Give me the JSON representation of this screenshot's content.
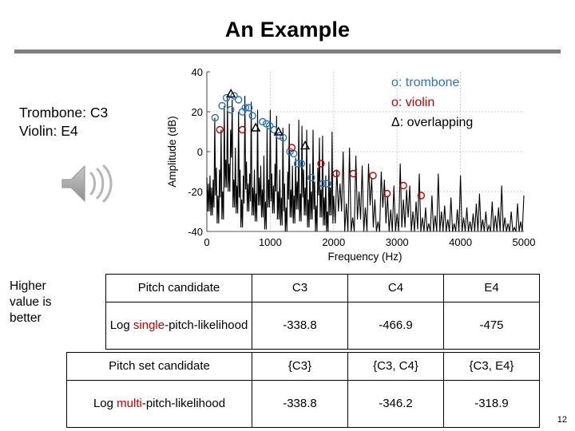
{
  "slide": {
    "title": "An Example",
    "page_number": "12",
    "accent_rule_color": "#808080"
  },
  "caption": {
    "line1": "Trombone: C3",
    "line2": "Violin: E4",
    "audio_icon": "speaker-icon"
  },
  "sidenote": {
    "line1": "Higher",
    "line2": "value is",
    "line3": "better"
  },
  "chart_data": {
    "type": "line",
    "title": "",
    "xlabel": "Frequency (Hz)",
    "ylabel": "Amplitude (dB)",
    "xlim": [
      0,
      5000
    ],
    "ylim": [
      -40,
      40
    ],
    "xticks": [
      0,
      1000,
      2000,
      3000,
      4000,
      5000
    ],
    "yticks": [
      -40,
      -20,
      0,
      20,
      40
    ],
    "grid": true,
    "legend_position": "top-right",
    "legend": [
      {
        "marker": "o",
        "label": "o: trombone",
        "color": "#2E75B6"
      },
      {
        "marker": "o",
        "label": "o: violin",
        "color": "#C00000"
      },
      {
        "marker": "triangle",
        "label": "Δ: overlapping",
        "color": "#000000"
      }
    ],
    "series": [
      {
        "name": "spectrum",
        "color": "#000000",
        "x": [
          0,
          25,
          50,
          75,
          100,
          125,
          150,
          175,
          200,
          225,
          250,
          275,
          300,
          325,
          350,
          375,
          400,
          425,
          450,
          475,
          500,
          525,
          550,
          575,
          600,
          625,
          650,
          675,
          700,
          725,
          750,
          775,
          800,
          825,
          850,
          875,
          900,
          925,
          950,
          975,
          1000,
          1025,
          1050,
          1075,
          1100,
          1125,
          1150,
          1175,
          1200,
          1225,
          1250,
          1275,
          1300,
          1325,
          1350,
          1375,
          1400,
          1425,
          1450,
          1475,
          1500,
          1525,
          1550,
          1575,
          1600,
          1625,
          1650,
          1675,
          1700,
          1725,
          1750,
          1775,
          1800,
          1825,
          1850,
          1875,
          1900,
          1925,
          1950,
          1975,
          2000,
          2050,
          2100,
          2150,
          2200,
          2250,
          2300,
          2350,
          2400,
          2450,
          2500,
          2550,
          2600,
          2650,
          2700,
          2750,
          2800,
          2850,
          2900,
          2950,
          3000,
          3050,
          3100,
          3150,
          3200,
          3250,
          3300,
          3350,
          3400,
          3450,
          3500,
          3550,
          3600,
          3650,
          3700,
          3750,
          3800,
          3850,
          3900,
          3950,
          4000,
          4050,
          4100,
          4150,
          4200,
          4250,
          4300,
          4350,
          4400,
          4450,
          4500,
          4550,
          4600,
          4650,
          4700,
          4750,
          4800,
          4850,
          4900,
          4950,
          5000
        ],
        "y": [
          -13,
          -16,
          -12,
          -18,
          -14,
          17,
          -8,
          -22,
          -9,
          11,
          -20,
          23,
          -4,
          27,
          -6,
          11,
          26,
          -14,
          2,
          -17,
          20,
          -9,
          -24,
          -12,
          28,
          -5,
          -16,
          -11,
          25,
          -18,
          -9,
          -21,
          21,
          -13,
          -7,
          -19,
          -2,
          -25,
          12,
          -14,
          21,
          -11,
          -17,
          -6,
          18,
          -20,
          -9,
          -23,
          12,
          -16,
          -28,
          -10,
          14,
          -19,
          -7,
          -22,
          -3,
          -15,
          16,
          -21,
          13,
          -9,
          -18,
          11,
          -24,
          -6,
          -20,
          11,
          -15,
          -27,
          -8,
          7,
          -19,
          8,
          -23,
          -12,
          -30,
          -5,
          -18,
          10,
          -22,
          -9,
          -16,
          0,
          -26,
          2,
          -33,
          -2,
          -20,
          -7,
          -28,
          -6,
          -13,
          -24,
          -35,
          -10,
          -14,
          -22,
          -29,
          -17,
          -31,
          -6,
          -24,
          -19,
          -17,
          -30,
          -25,
          -11,
          -33,
          -28,
          -36,
          -22,
          -32,
          -11,
          -30,
          -27,
          -34,
          -23,
          -36,
          -29,
          -12,
          -33,
          -28,
          -35,
          -31,
          -26,
          -21,
          -34,
          -30,
          -37,
          -25,
          -32,
          -28,
          -17,
          -33,
          -36,
          -30,
          -38,
          -26,
          -35,
          -22
        ]
      }
    ],
    "markers": {
      "trombone": {
        "color": "#2E75B6",
        "shape": "circle",
        "points": [
          [
            130,
            17
          ],
          [
            240,
            23
          ],
          [
            310,
            27
          ],
          [
            375,
            21
          ],
          [
            430,
            28
          ],
          [
            500,
            26
          ],
          [
            560,
            20
          ],
          [
            610,
            22
          ],
          [
            665,
            22
          ],
          [
            720,
            18
          ],
          [
            880,
            15
          ],
          [
            940,
            14
          ],
          [
            990,
            13
          ],
          [
            1060,
            11
          ],
          [
            1150,
            8
          ],
          [
            1205,
            7
          ],
          [
            1310,
            0
          ],
          [
            1370,
            -1
          ],
          [
            1430,
            -6
          ],
          [
            1490,
            -6
          ],
          [
            1650,
            -13
          ],
          [
            1830,
            -16
          ],
          [
            1900,
            -16
          ]
        ]
      },
      "violin": {
        "color": "#C00000",
        "shape": "circle",
        "points": [
          [
            205,
            11
          ],
          [
            560,
            11
          ],
          [
            1340,
            2
          ],
          [
            1800,
            -6
          ],
          [
            2040,
            -11
          ],
          [
            2310,
            -11
          ],
          [
            2620,
            -12
          ],
          [
            2840,
            -21
          ],
          [
            3100,
            -17
          ],
          [
            3380,
            -22
          ]
        ]
      },
      "overlapping": {
        "color": "#000000",
        "shape": "triangle",
        "points": [
          [
            380,
            29
          ],
          [
            770,
            12
          ],
          [
            1130,
            10
          ],
          [
            1550,
            3
          ]
        ]
      }
    }
  },
  "table_single": {
    "name": "single-pitch-likelihood-table",
    "header": {
      "label": "Pitch candidate",
      "columns": [
        "C3",
        "C4",
        "E4"
      ]
    },
    "row": {
      "label_prefix": "Log ",
      "label_highlight": "single",
      "label_suffix": "-pitch-likelihood",
      "values": [
        {
          "text": "-338.8",
          "color": "green"
        },
        {
          "text": "-466.9",
          "color": "green"
        },
        {
          "text": "-475",
          "color": "black"
        }
      ]
    }
  },
  "table_multi": {
    "name": "multi-pitch-likelihood-table",
    "header": {
      "label": "Pitch set candidate",
      "columns": [
        "{C3}",
        "{C3, C4}",
        "{C3, E4}"
      ]
    },
    "row": {
      "label_prefix": "Log ",
      "label_highlight": "multi",
      "label_suffix": "-pitch-likelihood",
      "values": [
        {
          "text": "-338.8",
          "color": "black"
        },
        {
          "text": "-346.2",
          "color": "black"
        },
        {
          "text": "-318.9",
          "color": "green"
        }
      ]
    }
  }
}
